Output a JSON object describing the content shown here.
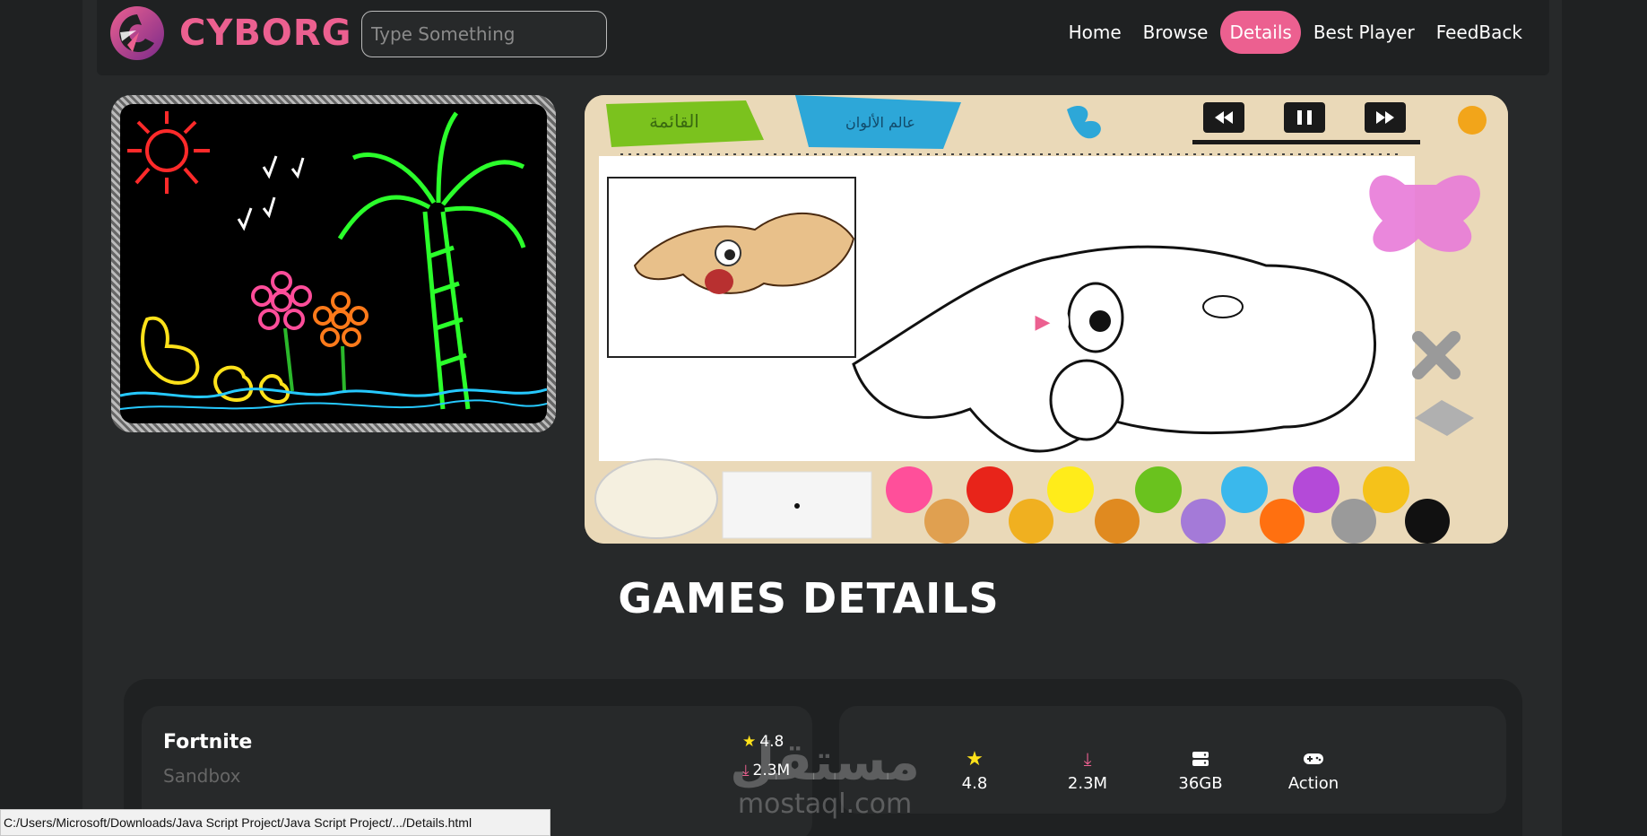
{
  "brand": {
    "name": "CYBORG",
    "accent": "#ec6090"
  },
  "search": {
    "placeholder": "Type Something"
  },
  "nav": {
    "items": [
      {
        "label": "Home"
      },
      {
        "label": "Browse"
      },
      {
        "label": "Details",
        "active": true
      },
      {
        "label": "Best Player"
      },
      {
        "label": "FeedBack"
      }
    ]
  },
  "banner_right": {
    "tab_list": "القائمة",
    "tab_colors": "عالم الألوان",
    "play_icon": "play-icon"
  },
  "section": {
    "title": "GAMES DETAILS"
  },
  "game": {
    "name": "Fortnite",
    "genre": "Sandbox",
    "rating": "4.8",
    "downloads": "2.3M"
  },
  "stats": {
    "rating": "4.8",
    "downloads": "2.3M",
    "size": "36GB",
    "type": "Action"
  },
  "watermark": {
    "arabic": "مستقل",
    "latin": "mostaql.com"
  },
  "statusbar": {
    "url": "C:/Users/Microsoft/Downloads/Java Script Project/Java Script Project/.../Details.html"
  }
}
